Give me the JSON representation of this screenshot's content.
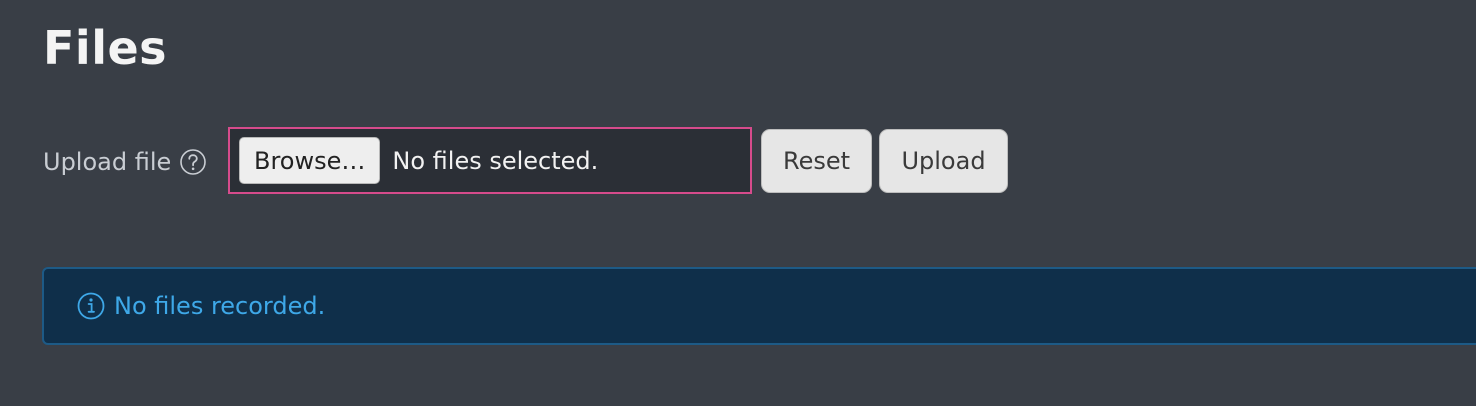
{
  "page": {
    "title": "Files"
  },
  "upload": {
    "label": "Upload file",
    "help_icon": "question-circle-icon",
    "browse_label": "Browse…",
    "file_status": "No files selected.",
    "reset_label": "Reset",
    "upload_label": "Upload"
  },
  "alert": {
    "icon": "info-circle-icon",
    "message": "No files recorded."
  },
  "colors": {
    "background": "#393e46",
    "focus_border": "#d64b8c",
    "alert_background": "#0f2f4a",
    "alert_border": "#1d5a86",
    "alert_text": "#3ea8e8"
  }
}
